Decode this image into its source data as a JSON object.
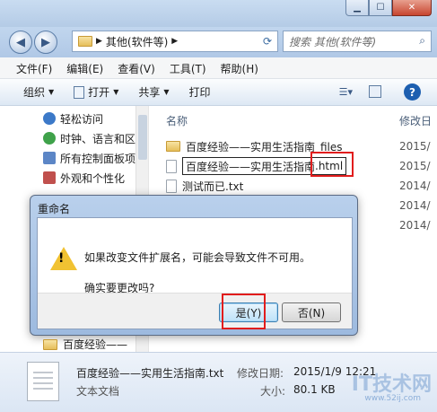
{
  "address": {
    "path": "其他(软件等)",
    "search_placeholder": "搜索 其他(软件等)"
  },
  "menu": [
    "文件(F)",
    "编辑(E)",
    "查看(V)",
    "工具(T)",
    "帮助(H)"
  ],
  "toolbar": {
    "organize": "组织",
    "open": "打开",
    "share": "共享",
    "print": "打印"
  },
  "nav": {
    "items": [
      "轻松访问",
      "时钟、语言和区",
      "所有控制面板项",
      "外观和个性化"
    ],
    "collapsed": "百度经验——"
  },
  "columns": {
    "name": "名称",
    "modified": "修改日"
  },
  "files": [
    {
      "name": "百度经验——实用生活指南_files",
      "date": "2015/"
    },
    {
      "name_main": "百度经验——实用生活指南",
      "name_ext": ".html",
      "date": "2015/"
    },
    {
      "name": "测试而已.txt",
      "date": "2014/"
    },
    {
      "date": "2014/"
    },
    {
      "date": "2014/"
    }
  ],
  "dialog": {
    "title": "重命名",
    "message": "如果改变文件扩展名，可能会导致文件不可用。",
    "question": "确实要更改吗?",
    "yes": "是(Y)",
    "no": "否(N)"
  },
  "details": {
    "name": "百度经验——实用生活指南.txt",
    "type": "文本文档",
    "modified_label": "修改日期:",
    "modified_value": "2015/1/9 12:21",
    "size_label": "大小:",
    "size_value": "80.1 KB",
    "watermark": "IT技术网",
    "watermark_url": "www.52ij.com"
  },
  "colors": {
    "highlight": "#e11d1d",
    "accent": "#1d5fb0"
  }
}
